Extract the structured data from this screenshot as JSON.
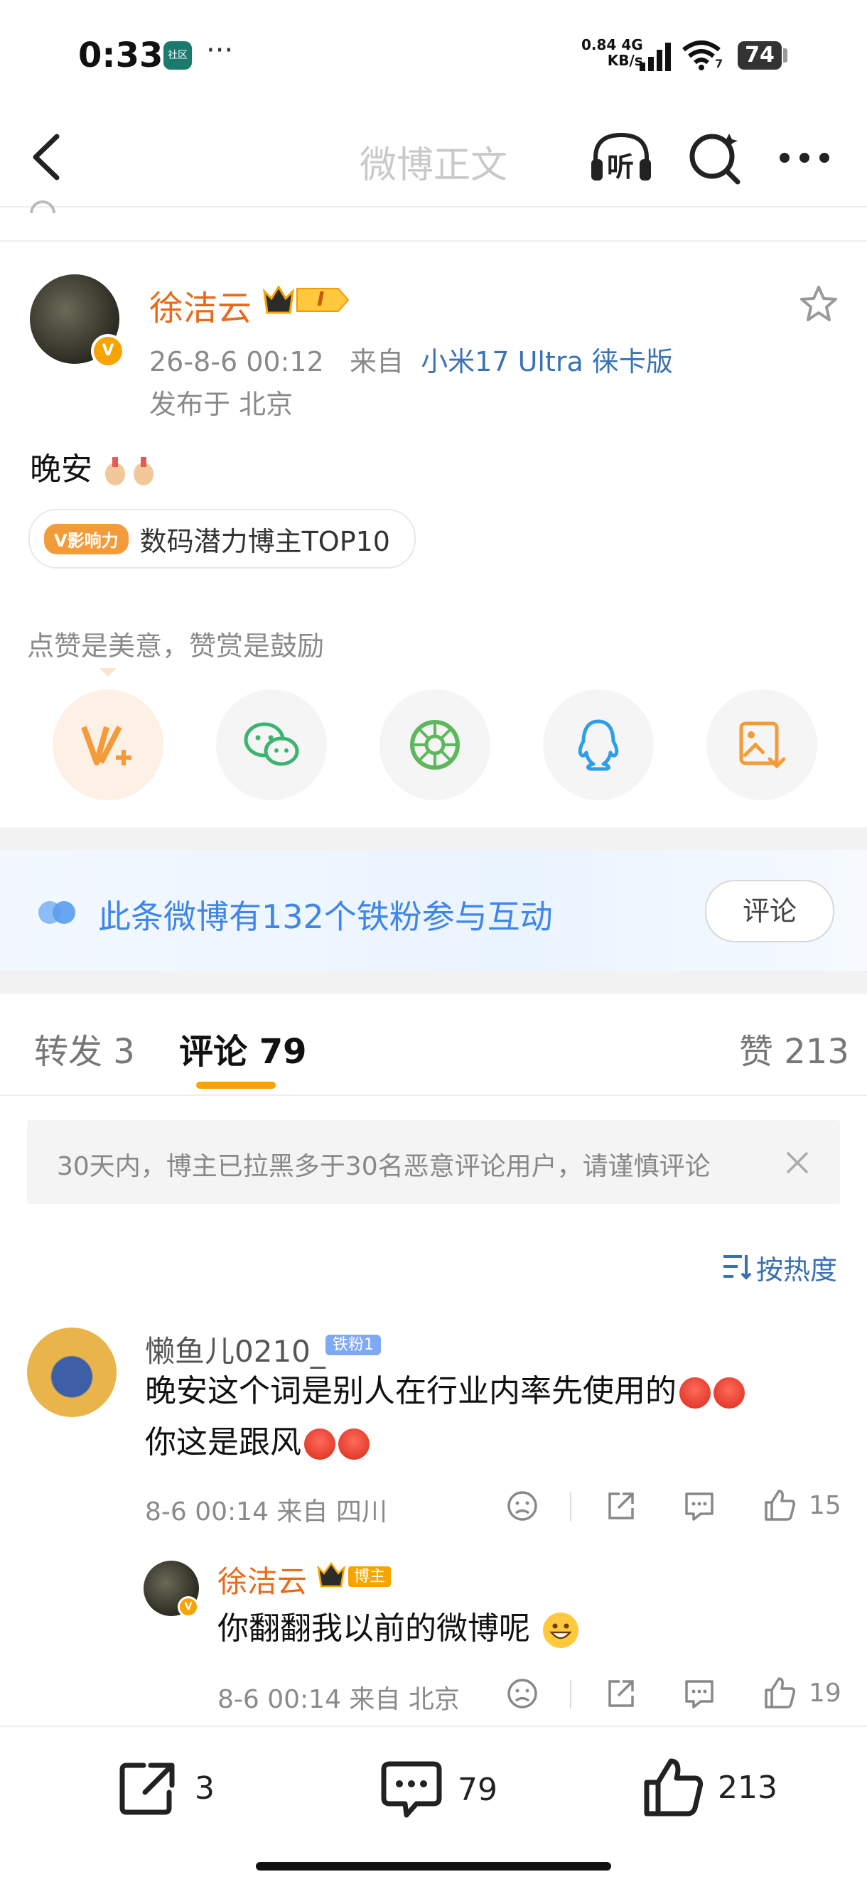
{
  "status_bar": {
    "time": "0:33",
    "app_badge": "社区",
    "more": "···",
    "net_speed_value": "0.84",
    "net_speed_unit": "KB/s",
    "net_type": "4G",
    "wifi_level": "7",
    "battery": "74"
  },
  "nav": {
    "title": "微博正文",
    "listen_label": "听"
  },
  "post": {
    "author": "徐洁云",
    "level_badge": "I",
    "time": "26-8-6 00:12",
    "source_prefix": "来自",
    "source": "小米17 Ultra 徕卡版",
    "location": "发布于 北京",
    "text": "晚安",
    "tag_badge": "V影响力",
    "tag_text": "数码潜力博主TOP10",
    "praise_prompt": "点赞是美意，赞赏是鼓励"
  },
  "fans_bar": {
    "text": "此条微博有132个铁粉参与互动",
    "button": "评论"
  },
  "tabs": {
    "repost": "转发 3",
    "comments": "评论 79",
    "likes": "赞 213"
  },
  "notice": {
    "text": "30天内，博主已拉黑多于30名恶意评论用户，请谨慎评论"
  },
  "sort": {
    "label": "按热度"
  },
  "comments": [
    {
      "name": "懒鱼儿0210_",
      "badge": "铁粉1",
      "line1": "晚安这个词是别人在行业内率先使用的",
      "line2": "你这是跟风",
      "meta": "8-6 00:14  来自 四川",
      "likes": "15"
    },
    {
      "name": "徐洁云",
      "badge": "博主",
      "line1": "你翻翻我以前的微博呢",
      "meta": "8-6 00:14  来自 北京",
      "likes": "19"
    }
  ],
  "bottom_bar": {
    "reposts": "3",
    "comments": "79",
    "likes": "213"
  },
  "colors": {
    "accent_orange": "#f7a300",
    "author_orange": "#e86b1b",
    "link_blue": "#3a73b5",
    "fans_blue": "#3f86e8"
  }
}
